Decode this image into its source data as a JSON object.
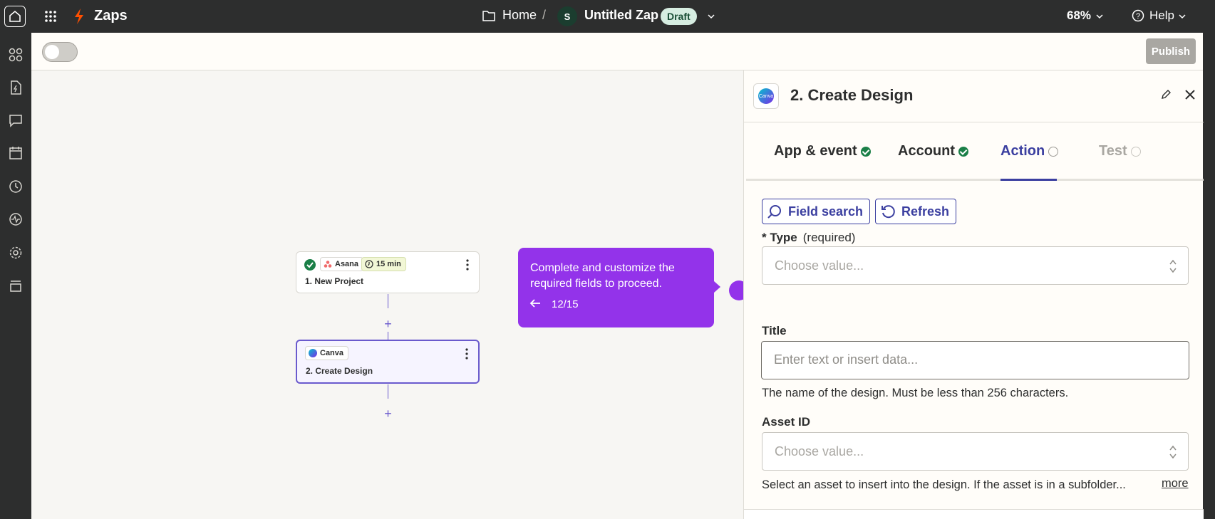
{
  "topbar": {
    "brand": "Zaps",
    "breadcrumb_home": "Home",
    "breadcrumb_separator": "/",
    "avatar_initial": "S",
    "zap_name": "Untitled Zap",
    "status_badge": "Draft",
    "zoom": "68%",
    "help": "Help"
  },
  "toolbar": {
    "publish_label": "Publish",
    "toggle_on": false
  },
  "canvas": {
    "nodes": [
      {
        "app": "Asana",
        "time": "15 min",
        "title": "1. New Project",
        "status": "complete"
      },
      {
        "app": "Canva",
        "title": "2. Create Design",
        "selected": true
      }
    ],
    "add_step_symbol": "+"
  },
  "tooltip": {
    "text": "Complete and customize the required fields to proceed.",
    "progress": "12/15"
  },
  "panel": {
    "title": "2. Create Design",
    "app_logo_text": "Canva",
    "tabs": [
      {
        "label": "App & event",
        "state": "complete"
      },
      {
        "label": "Account",
        "state": "complete"
      },
      {
        "label": "Action",
        "state": "active"
      },
      {
        "label": "Test",
        "state": "disabled"
      }
    ],
    "field_search_label": "Field search",
    "refresh_label": "Refresh",
    "fields": {
      "type": {
        "asterisk": "* ",
        "label": "Type",
        "required_note": "(required)",
        "placeholder": "Choose value..."
      },
      "title": {
        "label": "Title",
        "placeholder": "Enter text or insert data...",
        "help": "The name of the design. Must be less than 256 characters."
      },
      "asset_id": {
        "label": "Asset ID",
        "placeholder": "Choose value...",
        "help": "Select an asset to insert into the design. If the asset is in a subfolder...",
        "more": "more"
      }
    }
  },
  "colors": {
    "accent": "#3b3fa0",
    "tooltip": "#9333ea",
    "success": "#1a7f47",
    "zapier_orange": "#ff4f00"
  }
}
